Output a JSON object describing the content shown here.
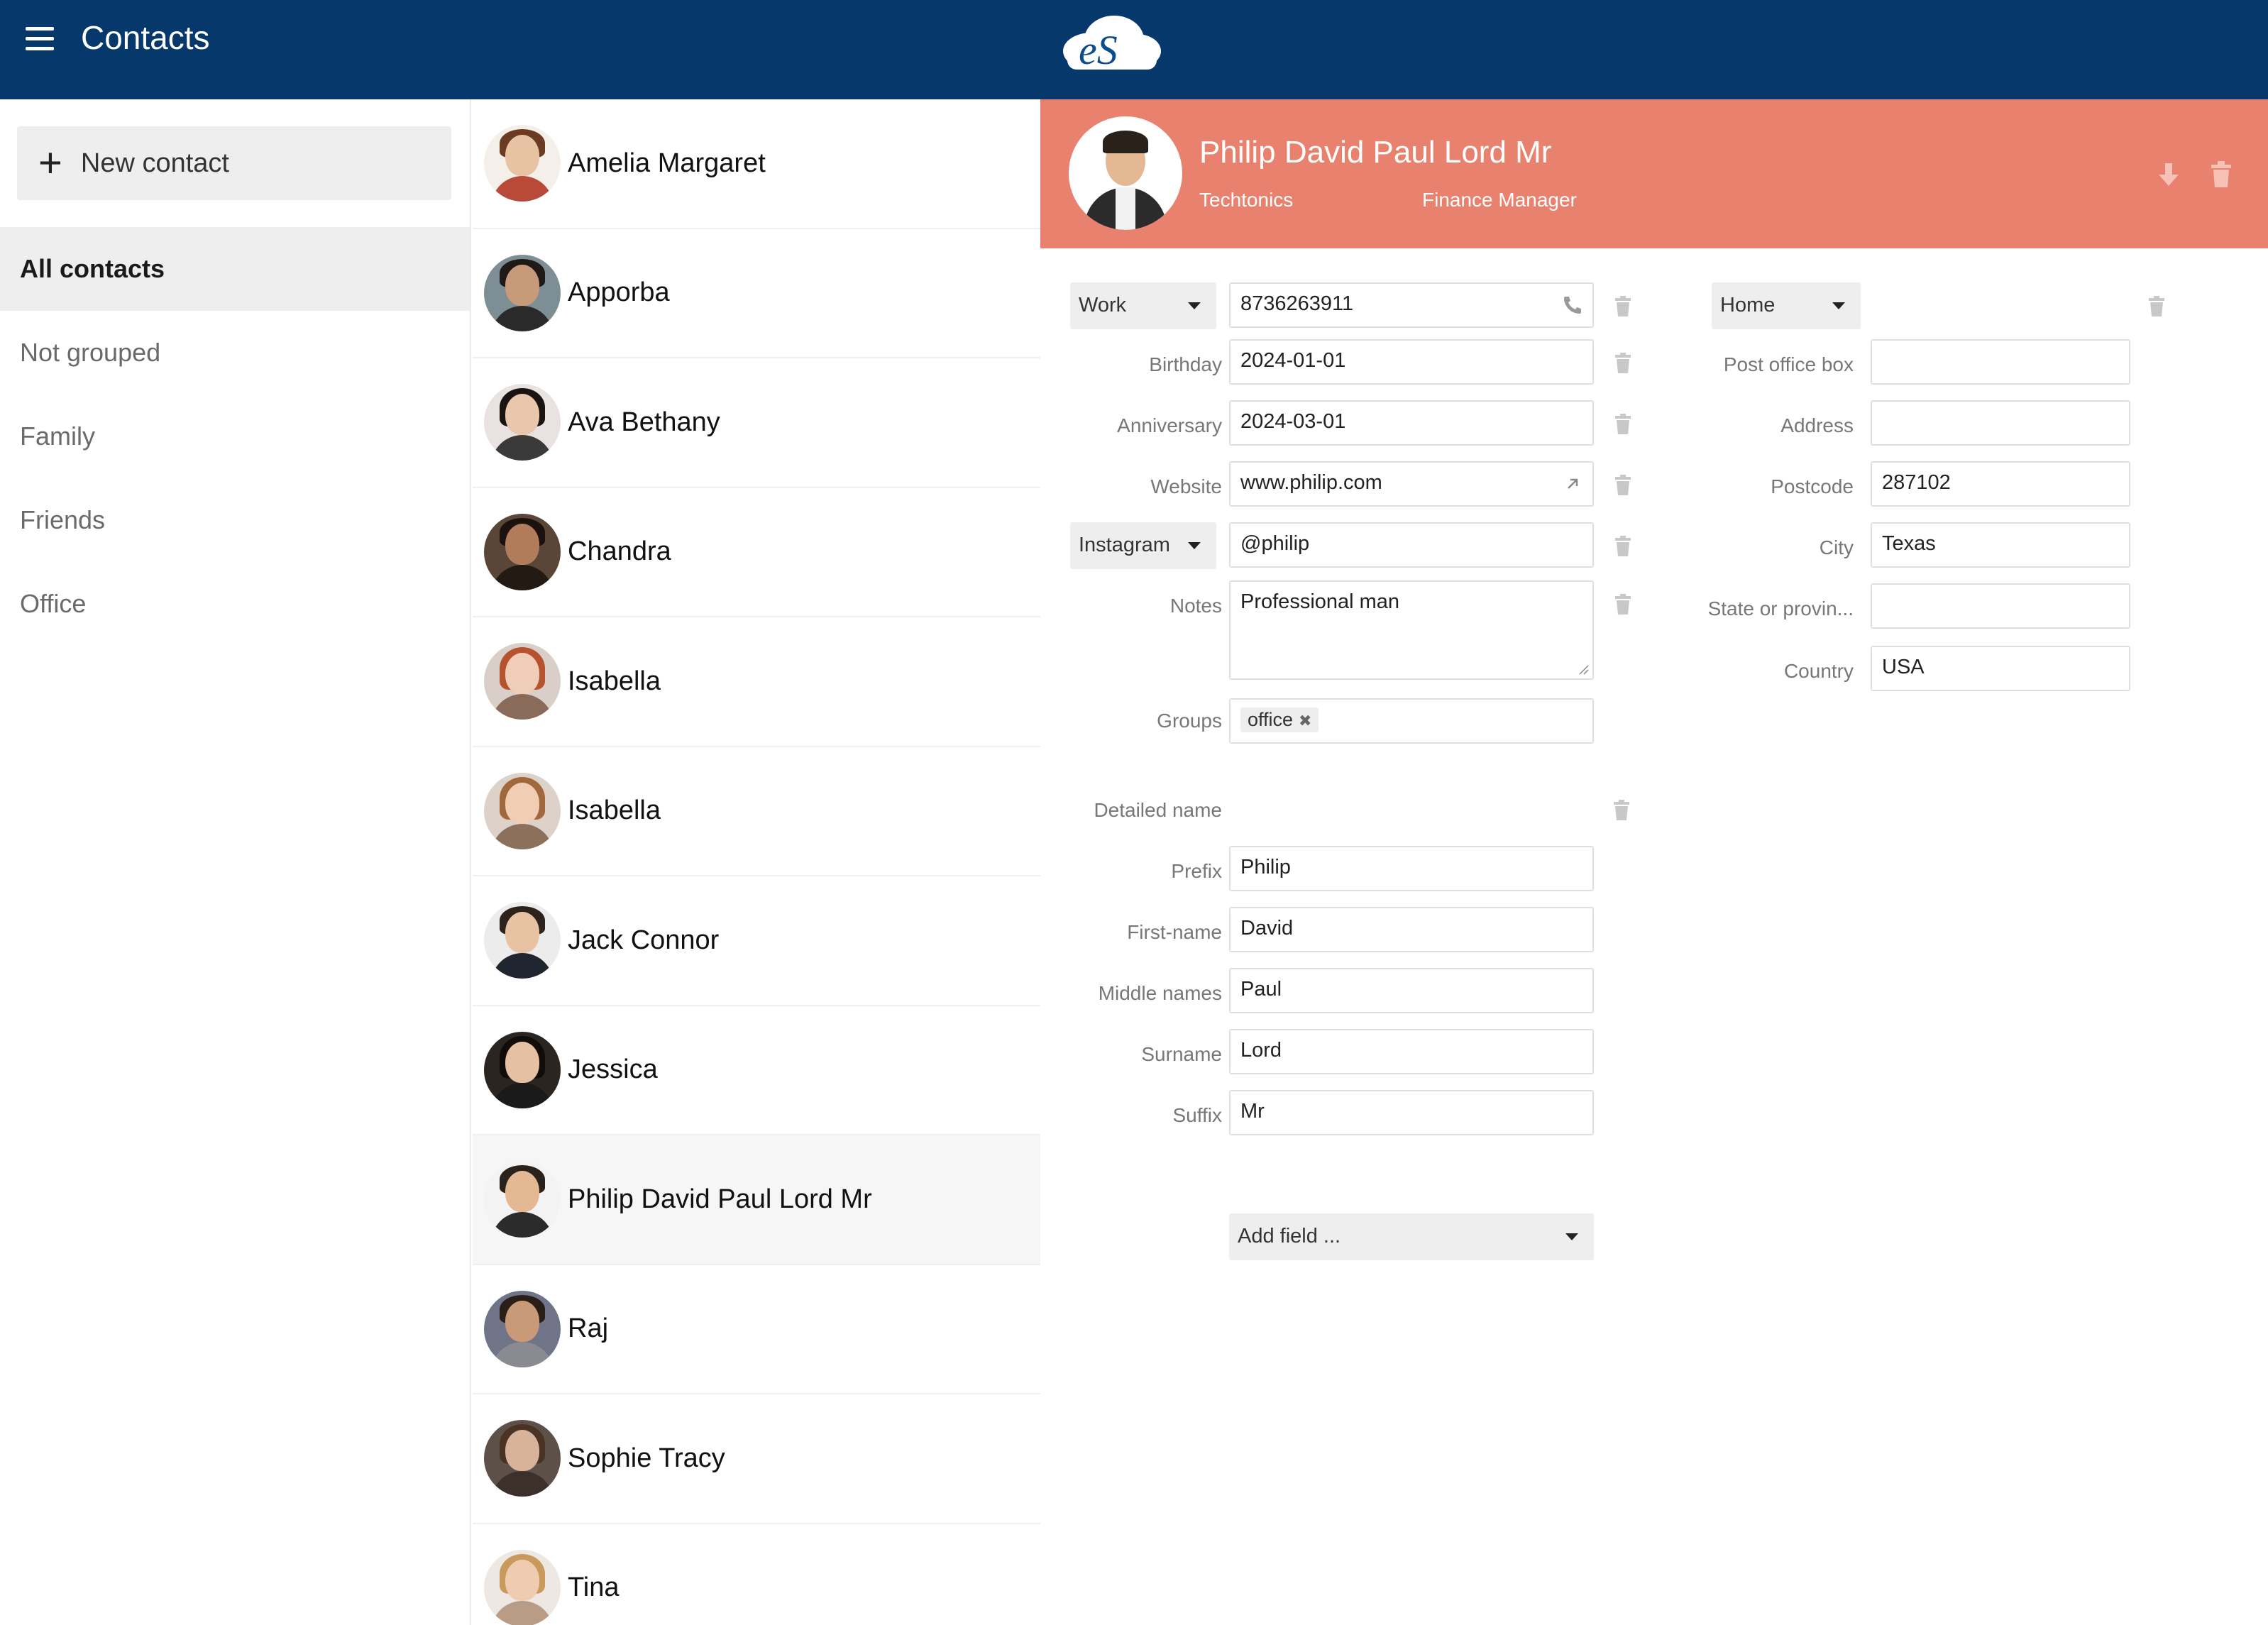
{
  "topbar": {
    "title": "Contacts",
    "logo_text": "eS"
  },
  "sidebar": {
    "new_contact": "New contact",
    "groups": [
      "All contacts",
      "Not grouped",
      "Family",
      "Friends",
      "Office"
    ]
  },
  "contacts": [
    "Amelia Margaret",
    "Apporba",
    "Ava Bethany",
    "Chandra",
    "Isabella",
    "Isabella",
    "Jack Connor",
    "Jessica",
    "Philip David Paul Lord Mr",
    "Raj",
    "Sophie Tracy",
    "Tina"
  ],
  "selected_contact": "Philip David Paul Lord Mr",
  "detail": {
    "name": "Philip David Paul Lord Mr",
    "company": "Techtonics",
    "job_title": "Finance Manager",
    "header_color": "#e8826e",
    "phone_type": "Work",
    "phone": "8736263911",
    "birthday_label": "Birthday",
    "birthday": "2024-01-01",
    "anniversary_label": "Anniversary",
    "anniversary": "2024-03-01",
    "website_label": "Website",
    "website": "www.philip.com",
    "social_type": "Instagram",
    "social": "@philip",
    "notes_label": "Notes",
    "notes": "Professional man",
    "groups_label": "Groups",
    "group_chip": "office",
    "detailed_name_label": "Detailed name",
    "prefix_label": "Prefix",
    "prefix": "Philip",
    "firstname_label": "First-name",
    "firstname": "David",
    "middle_label": "Middle names",
    "middle": "Paul",
    "surname_label": "Surname",
    "surname": "Lord",
    "suffix_label": "Suffix",
    "suffix": "Mr",
    "add_field": "Add field ...",
    "address_type": "Home",
    "pobox_label": "Post office box",
    "pobox": "",
    "address_label": "Address",
    "address": "",
    "postcode_label": "Postcode",
    "postcode": "287102",
    "city_label": "City",
    "city": "Texas",
    "state_label": "State or provin...",
    "state": "",
    "country_label": "Country",
    "country": "USA"
  }
}
